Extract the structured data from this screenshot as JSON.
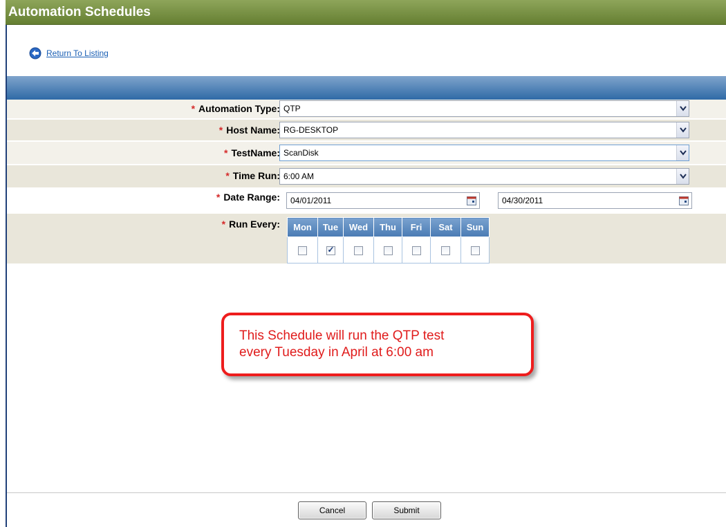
{
  "titlebar": {
    "title": "Automation Schedules"
  },
  "nav": {
    "return_label": "Return To Listing",
    "return_icon": "back-arrow-icon"
  },
  "form": {
    "required_marker": "*",
    "automation_type": {
      "label": "Automation Type:",
      "value": "QTP"
    },
    "host_name": {
      "label": "Host Name:",
      "value": "RG-DESKTOP"
    },
    "test_name": {
      "label": "TestName:",
      "value": "ScanDisk"
    },
    "time_run": {
      "label": "Time Run:",
      "value": "6:00 AM"
    },
    "date_range": {
      "label": "Date Range:",
      "start": "04/01/2011",
      "end": "04/30/2011"
    },
    "run_every": {
      "label": "Run Every:",
      "days": [
        {
          "name": "Mon",
          "checked": false
        },
        {
          "name": "Tue",
          "checked": true
        },
        {
          "name": "Wed",
          "checked": false
        },
        {
          "name": "Thu",
          "checked": false
        },
        {
          "name": "Fri",
          "checked": false
        },
        {
          "name": "Sat",
          "checked": false
        },
        {
          "name": "Sun",
          "checked": false
        }
      ]
    }
  },
  "callout": {
    "line1": "This Schedule will run the QTP test",
    "line2": "every Tuesday in April at 6:00 am"
  },
  "buttons": {
    "cancel": "Cancel",
    "submit": "Submit"
  },
  "colors": {
    "title_bar": "#748f3f",
    "band": "#4f84bc",
    "required": "#d52a2a",
    "callout": "#ee1d1d"
  }
}
